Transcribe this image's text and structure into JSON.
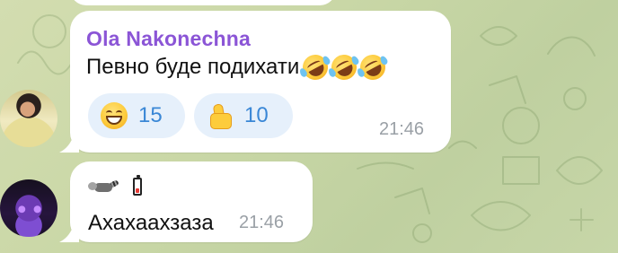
{
  "messages": [
    {
      "sender": "Ola Nakonechna",
      "text": "Певно буде подихати",
      "emoji": [
        "rolling-on-floor-laughing",
        "rolling-on-floor-laughing",
        "rolling-on-floor-laughing"
      ],
      "reactions": [
        {
          "emoji": "grinning-face",
          "count": "15"
        },
        {
          "emoji": "thumbs-up",
          "count": "10"
        }
      ],
      "time": "21:46"
    },
    {
      "icons": [
        "raccoon-icon",
        "low-battery-icon"
      ],
      "text": "Ахахаахзаза",
      "time": "21:46"
    }
  ],
  "colors": {
    "sender_name": "#8b55d6",
    "reaction_bg": "#e6f0fb",
    "reaction_text": "#3a87d6",
    "timestamp": "#9aa0a6",
    "wallpaper": "#c9d7a6"
  }
}
